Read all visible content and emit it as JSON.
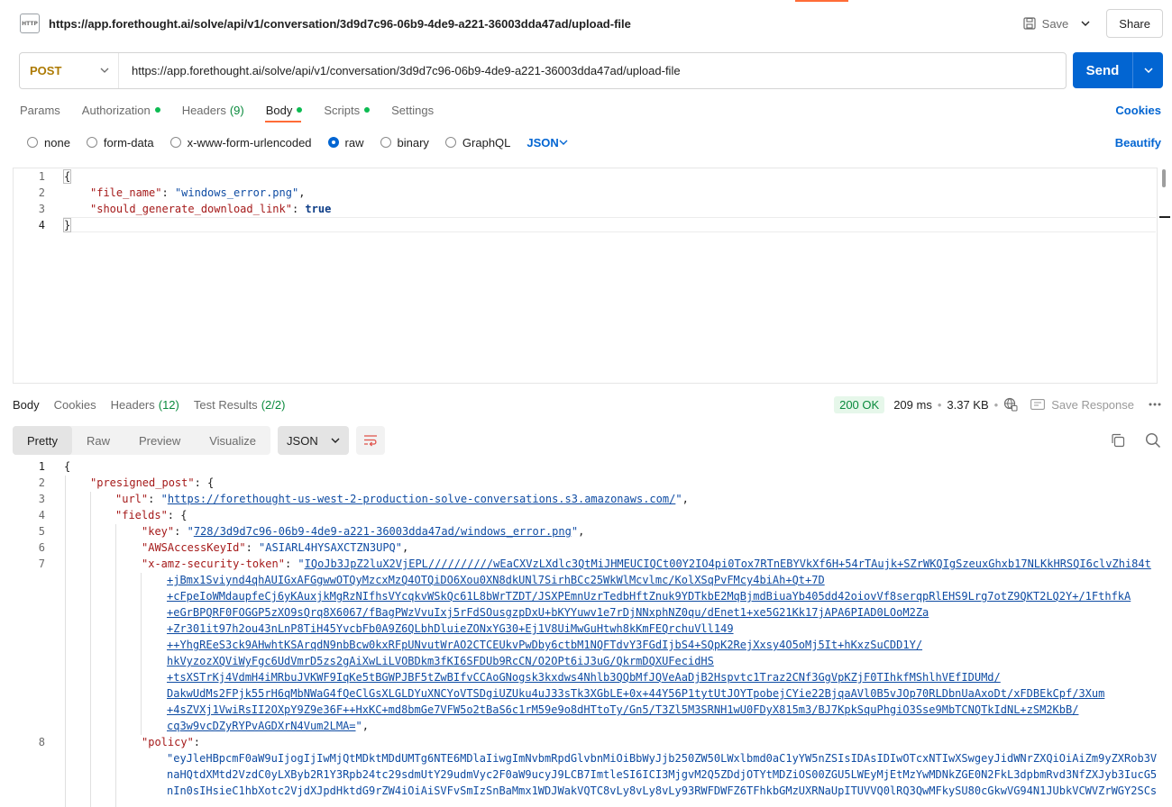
{
  "title_bar": {
    "icon_text": "HTTP",
    "url": "https://app.forethought.ai/solve/api/v1/conversation/3d9d7c96-06b9-4de9-a221-36003dda47ad/upload-file",
    "save_label": "Save",
    "share_label": "Share"
  },
  "request": {
    "method": "POST",
    "url": "https://app.forethought.ai/solve/api/v1/conversation/3d9d7c96-06b9-4de9-a221-36003dda47ad/upload-file",
    "send_label": "Send"
  },
  "request_tabs": {
    "params": "Params",
    "authorization": "Authorization",
    "headers": "Headers",
    "headers_count": "(9)",
    "body": "Body",
    "scripts": "Scripts",
    "settings": "Settings",
    "cookies": "Cookies"
  },
  "body_types": {
    "none": "none",
    "form_data": "form-data",
    "urlencoded": "x-www-form-urlencoded",
    "raw": "raw",
    "binary": "binary",
    "graphql": "GraphQL",
    "language": "JSON",
    "beautify": "Beautify",
    "selected": "raw"
  },
  "request_body": {
    "line_numbers": [
      "1",
      "2",
      "3",
      "4"
    ],
    "open_brace": "{",
    "close_brace": "}",
    "key1": "\"file_name\"",
    "val1": "\"windows_error.png\"",
    "key2": "\"should_generate_download_link\"",
    "val2": "true"
  },
  "response_tabs": {
    "body": "Body",
    "cookies": "Cookies",
    "headers": "Headers",
    "headers_count": "(12)",
    "test_results": "Test Results",
    "test_count": "(2/2)",
    "status": "200 OK",
    "time": "209 ms",
    "size": "3.37 KB",
    "save_response": "Save Response"
  },
  "response_toolbar": {
    "pretty": "Pretty",
    "raw": "Raw",
    "preview": "Preview",
    "visualize": "Visualize",
    "format": "JSON"
  },
  "response_body": {
    "line_numbers": [
      "1",
      "2",
      "3",
      "4",
      "5",
      "6",
      "7",
      "8"
    ],
    "l1": "{",
    "presigned_post_key": "\"presigned_post\"",
    "url_key": "\"url\"",
    "url_val": "https://forethought-us-west-2-production-solve-conversations.s3.amazonaws.com/",
    "fields_key": "\"fields\"",
    "key_key": "\"key\"",
    "key_val": "728/3d9d7c96-06b9-4de9-a221-36003dda47ad/windows_error.png",
    "akid_key": "\"AWSAccessKeyId\"",
    "akid_val": "\"ASIARL4HYSAXCTZN3UPQ\"",
    "token_key": "\"x-amz-security-token\"",
    "token_lines": [
      "IQoJb3JpZ2luX2VjEPL//////////wEaCXVzLXdlc3QtMiJHMEUCIQCt00Y2IO4pi0Tox7RTnEBYVkXf6H+54rTAujk+SZrWKQIgSzeuxGhxb17NLKkHRSQI6clvZhi84t",
      "+jBmx1Sviynd4qhAUIGxAFGgwwOTQyMzcxMzQ4OTQiDO6Xou0XN8dkUNl7SirhBCc25WkWlMcvlmc/KolXSqPvFMcy4biAh+Qt+7D",
      "+cFpeIoWMdaupfeCj6yKAuxjkMgRzNIfhsVYcqkvWSkQc61L8bWrTZDT/JSXPEmnUzrTedbHftZnuk9YDTkbE2MqBjmdBiuaYb405dd42oiovVf8serqpRlEHS9Lrg7otZ9QKT2LQ2Y+/1FthfkA",
      "+eGrBPQRF0FOGGP5zXO9sQrq8X6067/fBagPWzVvuIxj5rFdSOusgzpDxU+bKYYuwv1e7rDjNNxphNZ0qu/dEnet1+xe5G21Kk17jAPA6PIAD0LOoM2Za",
      "+Zr301it97h2ou43nLnP8TiH45YvcbFb0A9Z6QLbhDluieZONxYG30+Ej1V8UiMwGuHtwh8kKmFEQrchuVll149",
      "++YhgREeS3ck9AHwhtKSArqdN9nbBcw0kxRFpUNvutWrAO2CTCEUkvPwDby6ctbM1NQFTdvY3FGdIjbS4+SQpK2RejXxsy4O5oMj5It+hKxzSuCDD1Y/",
      "hkVyzozXQViWyFgc6UdVmrD5zs2gAiXwLiLVOBDkm3fKI6SFDUb9RcCN/O2OPt6iJ3uG/QkrmDQXUFecidHS",
      "+tsXSTrKj4VdmH4iMRbuJVKWF9IqKe5tBGWPJBF5tZwBIfvCCAoGNogsk3kxdws4Nhlb3QQbMfJQVeAaDjB2Hspvtc1Traz2CNf3GgVpKZjF0TIhkfMShlhVEfIDUMd/",
      "DakwUdMs2FPjk55rH6qMbNWaG4fQeClGsXLGLDYuXNCYoVTSDgiUZUku4uJ33sTk3XGbLE+0x+44Y56P1tytUtJOYTpobejCYie22BjqaAVl0B5vJOp70RLDbnUaAxoDt/xFDBEkCpf/3Xum",
      "+4sZVXj1VwiRsII2OXpY9Z9e36F++HxKC+md8bmGe7VFW5o2tBaS6c1rM59e9o8dHTtoTy/Gn5/T3Zl5M3SRNH1wU0FDyX815m3/BJ7KpkSquPhgiO3Sse9MbTCNQTkIdNL+zSM2KbB/",
      "cq3w9vcDZyRYPvAGDXrN4Vum2LMA="
    ],
    "policy_key": "\"policy\"",
    "policy_lines": [
      "\"eyJleHBpcmF0aW9uIjogIjIwMjQtMDktMDdUMTg6NTE6MDlaIiwgImNvbmRpdGlvbnMiOiBbWyJjb250ZW50LWxlbmd0aC1yYW5nZSIsIDAsIDIwOTcxNTIwXSwgeyJidWNrZXQiOiAiZm9yZXRob3V",
      "naHQtdXMtd2VzdC0yLXByb2R1Y3Rpb24tc29sdmUtY29udmVyc2F0aW9ucyJ9LCB7ImtleSI6ICI3MjgvM2Q5ZDdjOTYtMDZiOS00ZGU5LWEyMjEtMzYwMDNkZGE0N2FkL3dpbmRvd3NfZXJyb3IucG5",
      "nIn0sIHsieC1hbXotc2VjdXJpdHktdG9rZW4iOiAiSVFvSmIzSnBaMmx1WDJWakVQTC8vLy8vLy8vLy93RWFDWFZ6TFhkbGMzUXRNaUpITUVVQ0lRQ3QwMFkySU80cGkwVG94N1JUbkVCWVZrWGY2SCs"
    ]
  }
}
